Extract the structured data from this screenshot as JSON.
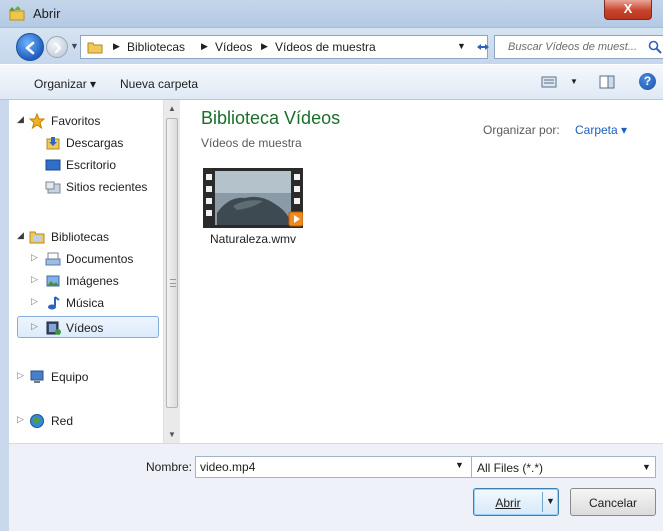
{
  "window": {
    "title": "Abrir",
    "close_glyph": "X"
  },
  "address": {
    "crumbs": [
      "Bibliotecas",
      "Vídeos",
      "Vídeos de muestra"
    ],
    "search_placeholder": "Buscar Vídeos de muest..."
  },
  "toolbar": {
    "organize_label": "Organizar ▾",
    "new_folder_label": "Nueva carpeta",
    "help_glyph": "?"
  },
  "nav": {
    "items": [
      {
        "label": "Favoritos",
        "icon": "star-icon",
        "level": 0
      },
      {
        "label": "Descargas",
        "icon": "downloads-folder-icon",
        "level": 1
      },
      {
        "label": "Escritorio",
        "icon": "desktop-icon",
        "level": 1
      },
      {
        "label": "Sitios recientes",
        "icon": "recent-places-icon",
        "level": 1
      },
      {
        "label": "Bibliotecas",
        "icon": "libraries-icon",
        "level": 0
      },
      {
        "label": "Documentos",
        "icon": "documents-icon",
        "level": 1
      },
      {
        "label": "Imágenes",
        "icon": "pictures-icon",
        "level": 1
      },
      {
        "label": "Música",
        "icon": "music-icon",
        "level": 1
      },
      {
        "label": "Vídeos",
        "icon": "videos-icon",
        "level": 1,
        "selected": true
      },
      {
        "label": "Equipo",
        "icon": "computer-icon",
        "level": 0
      },
      {
        "label": "Red",
        "icon": "network-icon",
        "level": 0
      }
    ]
  },
  "content": {
    "library_title": "Biblioteca Vídeos",
    "library_subtitle": "Vídeos de muestra",
    "arrange_label": "Organizar por:",
    "arrange_value": "Carpeta ▾",
    "files": [
      {
        "name": "Naturaleza.wmv",
        "icon": "video-thumbnail-icon"
      }
    ]
  },
  "footer": {
    "name_label": "Nombre:",
    "name_value": "video.mp4",
    "filter_value": "All Files (*.*)",
    "open_label": "Abrir",
    "cancel_label": "Cancelar"
  },
  "colors": {
    "accent": "#1a6e2c",
    "link": "#1e5fbf",
    "selection_border": "#84acdd"
  }
}
